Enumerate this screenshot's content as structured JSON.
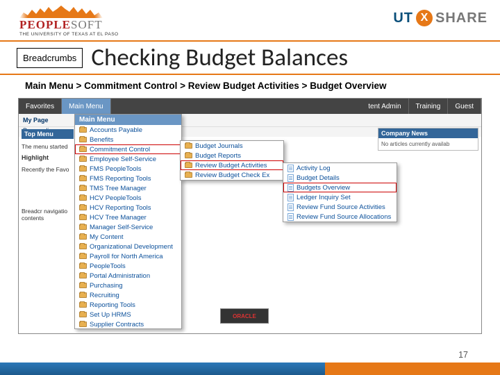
{
  "logos": {
    "left_brand_a": "PEOPLE",
    "left_brand_b": "SOFT",
    "left_sub": "THE UNIVERSITY OF TEXAS AT EL PASO",
    "right_a": "UT",
    "right_x": "X",
    "right_b": "SHARE"
  },
  "title_box": "Breadcrumbs",
  "title": "Checking Budget Balances",
  "breadcrumb_path": "Main Menu  > Commitment Control > Review Budget Activities > Budget Overview",
  "topbar": {
    "t1": "Favorites",
    "t2": "Main Menu",
    "t3": "tent Admin",
    "t4": "Training",
    "t5": "Guest"
  },
  "subrow": {
    "a": "My Page",
    "b": "Personalize"
  },
  "leftpane": {
    "hdr1": "Top Menu",
    "p1": "The menu started",
    "hdr2": "Highlight",
    "p2": "Recently the Favo",
    "p3": "Breadcr navigatio contents"
  },
  "menu1": {
    "hdr": "Main Menu",
    "items": [
      "Accounts Payable",
      "Benefits",
      "Commitment Control",
      "Employee Self-Service",
      "FMS PeopleTools",
      "FMS Reporting Tools",
      "TMS Tree Manager",
      "HCV PeopleTools",
      "HCV Reporting Tools",
      "HCV Tree Manager",
      "Manager Self-Service",
      "My Content",
      "Organizational Development",
      "Payroll for North America",
      "PeopleTools",
      "Portal Administration",
      "Purchasing",
      "Recruiting",
      "Reporting Tools",
      "Set Up HRMS",
      "Supplier Contracts"
    ]
  },
  "menu2": {
    "items": [
      "Budget Journals",
      "Budget Reports",
      "Review Budget Activities",
      "Review Budget Check Ex"
    ]
  },
  "menu3": {
    "items": [
      "Activity Log",
      "Budget Details",
      "Budgets Overview",
      "Ledger Inquiry Set",
      "Review Fund Source Activities",
      "Review Fund Source Allocations"
    ]
  },
  "news": {
    "hdr": "Company News",
    "body": "No articles currently availab"
  },
  "oracle": "ORACLE",
  "page_number": "17"
}
